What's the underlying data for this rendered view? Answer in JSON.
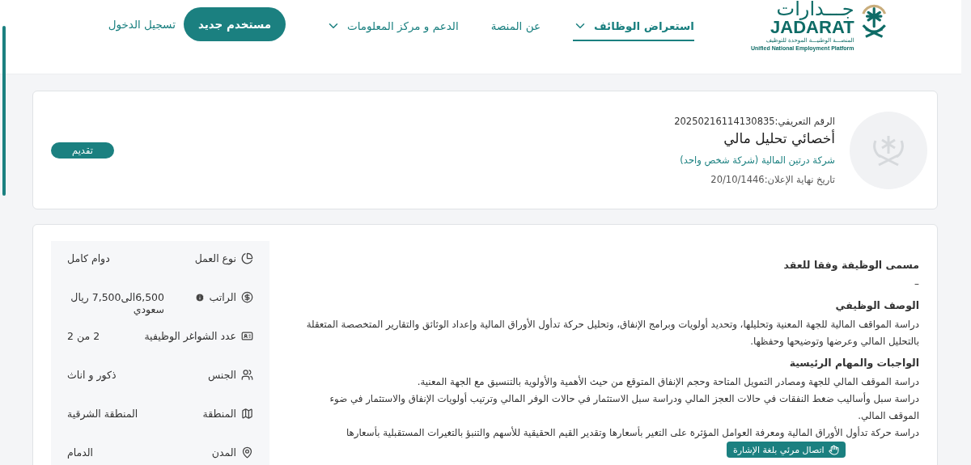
{
  "header": {
    "logo": {
      "name_ar": "جـــدارات",
      "name_en": "JADARAT",
      "tagline_ar": "المنصـــة الوطنيـــة الموحدة للتوظيف",
      "tagline_en": "Unified National Employment Platform"
    },
    "nav": [
      {
        "label": "استعراض الوظائف",
        "dropdown": true,
        "selected": true
      },
      {
        "label": "عن المنصة",
        "dropdown": false,
        "selected": false
      },
      {
        "label": "الدعم و مركز المعلومات",
        "dropdown": true,
        "selected": false
      }
    ],
    "register_button": "مستخدم جديد",
    "login_link": "تسجيل الدخول"
  },
  "job": {
    "id": "الرقم التعريفي:20250216114130835",
    "title": "أخصائي تحليل مالي",
    "company": "شركة درتين المالية (شركة شخص واحد)",
    "deadline": "تاريخ نهاية الإعلان:20/10/1446",
    "apply_button": "تقديم"
  },
  "sections": [
    {
      "heading": "مسمى الوظيفة وفقا للعقد",
      "paragraphs": [
        "–"
      ]
    },
    {
      "heading": "الوصف الوظيفي",
      "paragraphs": [
        "دراسة المواقف المالية للجهة المعنية وتحليلها، وتحديد أولويات وبرامج الإنفاق، وتحليل حركة تدأول الأوراق المالية وإعداد الوثائق والتقارير المتخصصة المتعقلة بالتحليل المالي وعرضها وتوضيحها وحفظها."
      ]
    },
    {
      "heading": "الواجبات والمهام الرئيسية",
      "paragraphs": [
        "دراسة الموقف المالي للجهة ومصادر التمويل المتاحة وحجم الإنفاق المتوقع من حيث الأهمية والأولوية بالتنسيق مع الجهة المعنية.",
        "دراسة سبل وأساليب ضغط النفقات في حالات العجز المالي ودراسة سبل الاستثمار في حالات الوفر المالي وترتيب أولويات الإنفاق والاستثمار في ضوء الموقف المالي.",
        "دراسة حركة تدأول الأوراق المالية ومعرفة العوامل المؤثرة على التغير بأسعارها وتقدير القيم الحقيقية للأسهم والتنبؤ بالتغيرات المستقبلية بأسعارها"
      ]
    }
  ],
  "facts": [
    {
      "label": "نوع العمل",
      "value": "دوام كامل",
      "info": false
    },
    {
      "label": "الراتب",
      "value": "6,500الى7,500 ريال سعودي",
      "info": true
    },
    {
      "label": "عدد الشواغر الوظيفية",
      "value": "2 من 2",
      "info": false
    },
    {
      "label": "الجنس",
      "value": "ذكور و اناث",
      "info": false
    },
    {
      "label": "المنطقة",
      "value": "المنطقة الشرقية",
      "info": false
    },
    {
      "label": "المدن",
      "value": "الدمام",
      "info": false
    }
  ],
  "sign_language_button": "اتصال مرئي بلغة الإشارة"
}
